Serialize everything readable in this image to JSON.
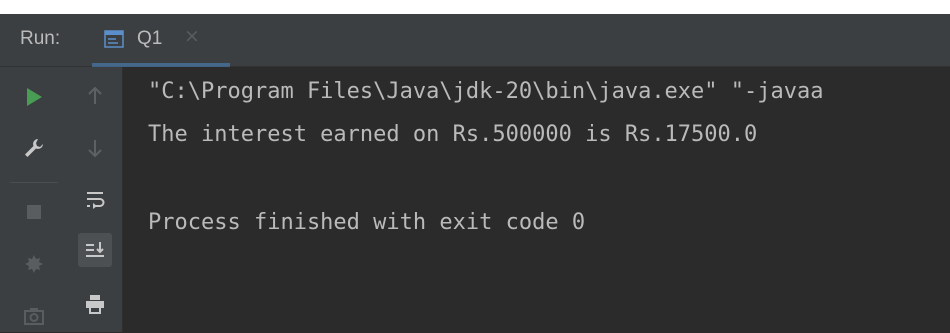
{
  "run_panel": {
    "label": "Run:",
    "tab": {
      "title": "Q1",
      "close_glyph": "×",
      "icon": "console-icon"
    }
  },
  "left_toolbar": {
    "icons": [
      "rerun-icon",
      "wrench-icon",
      "stop-icon",
      "restore-layout-icon",
      "camera-icon"
    ]
  },
  "side_toolbar": {
    "icons": [
      "up-arrow-icon",
      "down-arrow-icon",
      "soft-wrap-icon",
      "scroll-to-end-icon",
      "print-icon"
    ]
  },
  "console": {
    "lines": [
      "\"C:\\Program Files\\Java\\jdk-20\\bin\\java.exe\" \"-javaa",
      "The interest earned on Rs.500000 is Rs.17500.0",
      "",
      "Process finished with exit code 0"
    ]
  },
  "colors": {
    "panel_bg": "#3c3f41",
    "console_bg": "#2b2b2b",
    "text": "#bababa",
    "run_green": "#499c54",
    "accent_blue": "#4a88c7"
  }
}
